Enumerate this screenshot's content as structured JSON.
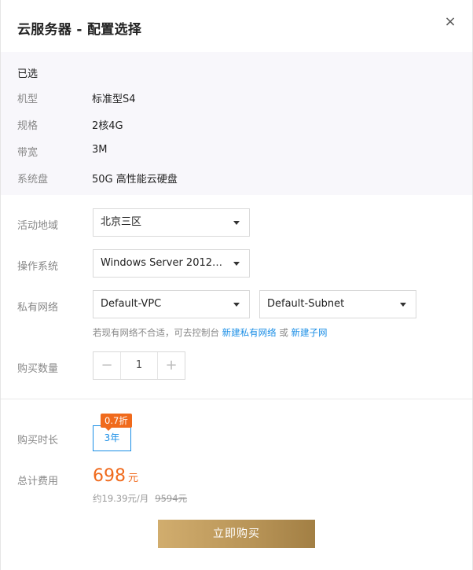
{
  "dialog": {
    "title": "云服务器 - 配置选择",
    "close_symbol": "×"
  },
  "selected": {
    "heading": "已选",
    "rows": [
      {
        "label": "机型",
        "value": "标准型S4"
      },
      {
        "label": "规格",
        "value": "2核4G"
      },
      {
        "label": "带宽",
        "value": "3M"
      },
      {
        "label": "系统盘",
        "value": "50G 高性能云硬盘"
      }
    ]
  },
  "form": {
    "region": {
      "label": "活动地域",
      "value": "北京三区"
    },
    "os": {
      "label": "操作系统",
      "value": "Windows Server 2012…"
    },
    "network": {
      "label": "私有网络",
      "vpc": "Default-VPC",
      "subnet": "Default-Subnet",
      "hint_text": "若现有网络不合适，可去控制台",
      "hint_link_vpc": "新建私有网络",
      "hint_or": "或",
      "hint_link_subnet": "新建子网"
    },
    "quantity": {
      "label": "购买数量",
      "value": "1",
      "minus": "−",
      "plus": "+"
    }
  },
  "purchase": {
    "duration_label": "购买时长",
    "duration_option": "3年",
    "discount_badge": "0.7折",
    "total_label": "总计费用",
    "price": "698",
    "price_unit": "元",
    "monthly": "约19.39元/月",
    "original_price": "9594元",
    "buy_button": "立即购买"
  },
  "colors": {
    "accent_blue": "#1a8ee6",
    "price_orange": "#f06a1c",
    "buy_gold": "#b89457"
  }
}
